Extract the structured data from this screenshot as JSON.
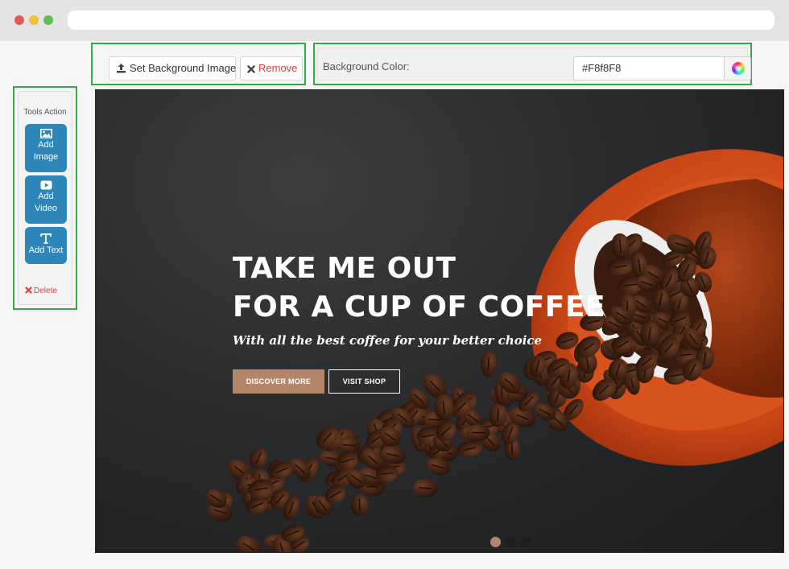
{
  "toolbar": {
    "set_background_label": "Set Background Image",
    "remove_label": "Remove",
    "background_color_label": "Background Color:",
    "background_color_value": "#F8f8F8"
  },
  "tools": {
    "title": "Tools Action",
    "add_image_line1": "Add",
    "add_image_line2": "Image",
    "add_video_line1": "Add",
    "add_video_line2": "Video",
    "add_text_label": "Add Text",
    "delete_label": "Delete"
  },
  "hero": {
    "title_line1": "TAKE ME OUT",
    "title_line2": "FOR A CUP OF COFFEE",
    "subtitle": "With all the best coffee for your better choice",
    "discover_label": "DISCOVER MORE",
    "shop_label": "VISIT SHOP",
    "slides_total": 3,
    "slide_active": 1
  },
  "colors": {
    "accent_blue": "#2e86b8",
    "accent_brown": "#b48668",
    "highlight_green": "#33aa44",
    "delete_red": "#d9403a"
  }
}
